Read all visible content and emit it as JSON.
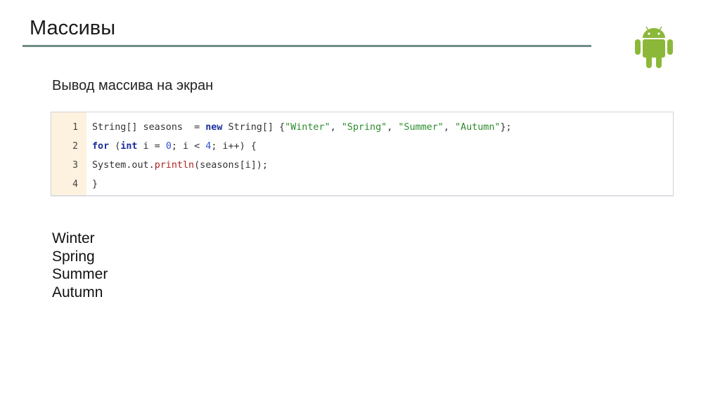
{
  "title": "Массивы",
  "subtitle": "Вывод массива на экран",
  "logo": "android-logo",
  "colors": {
    "rule": "#6f8c86",
    "android": "#8cb83a",
    "gutter": "#fdf1df"
  },
  "code": {
    "line_numbers": [
      "1",
      "2",
      "3",
      "4"
    ],
    "lines": [
      [
        [
          "String[] seasons  = ",
          ""
        ],
        [
          "new",
          "kw"
        ],
        [
          " String[] {",
          ""
        ],
        [
          "\"Winter\"",
          "str"
        ],
        [
          ", ",
          ""
        ],
        [
          "\"Spring\"",
          "str"
        ],
        [
          ", ",
          ""
        ],
        [
          "\"Summer\"",
          "str"
        ],
        [
          ", ",
          ""
        ],
        [
          "\"Autumn\"",
          "str"
        ],
        [
          "};",
          ""
        ]
      ],
      [
        [
          "for",
          "kw"
        ],
        [
          " (",
          ""
        ],
        [
          "int",
          "kw"
        ],
        [
          " i = ",
          ""
        ],
        [
          "0",
          "num"
        ],
        [
          "; i < ",
          ""
        ],
        [
          "4",
          "num"
        ],
        [
          "; i++) {",
          ""
        ]
      ],
      [
        [
          "System.out.",
          ""
        ],
        [
          "println",
          "fn"
        ],
        [
          "(seasons[i]);",
          ""
        ]
      ],
      [
        [
          "}",
          ""
        ]
      ]
    ]
  },
  "output": [
    "Winter",
    "Spring",
    "Summer",
    "Autumn"
  ]
}
